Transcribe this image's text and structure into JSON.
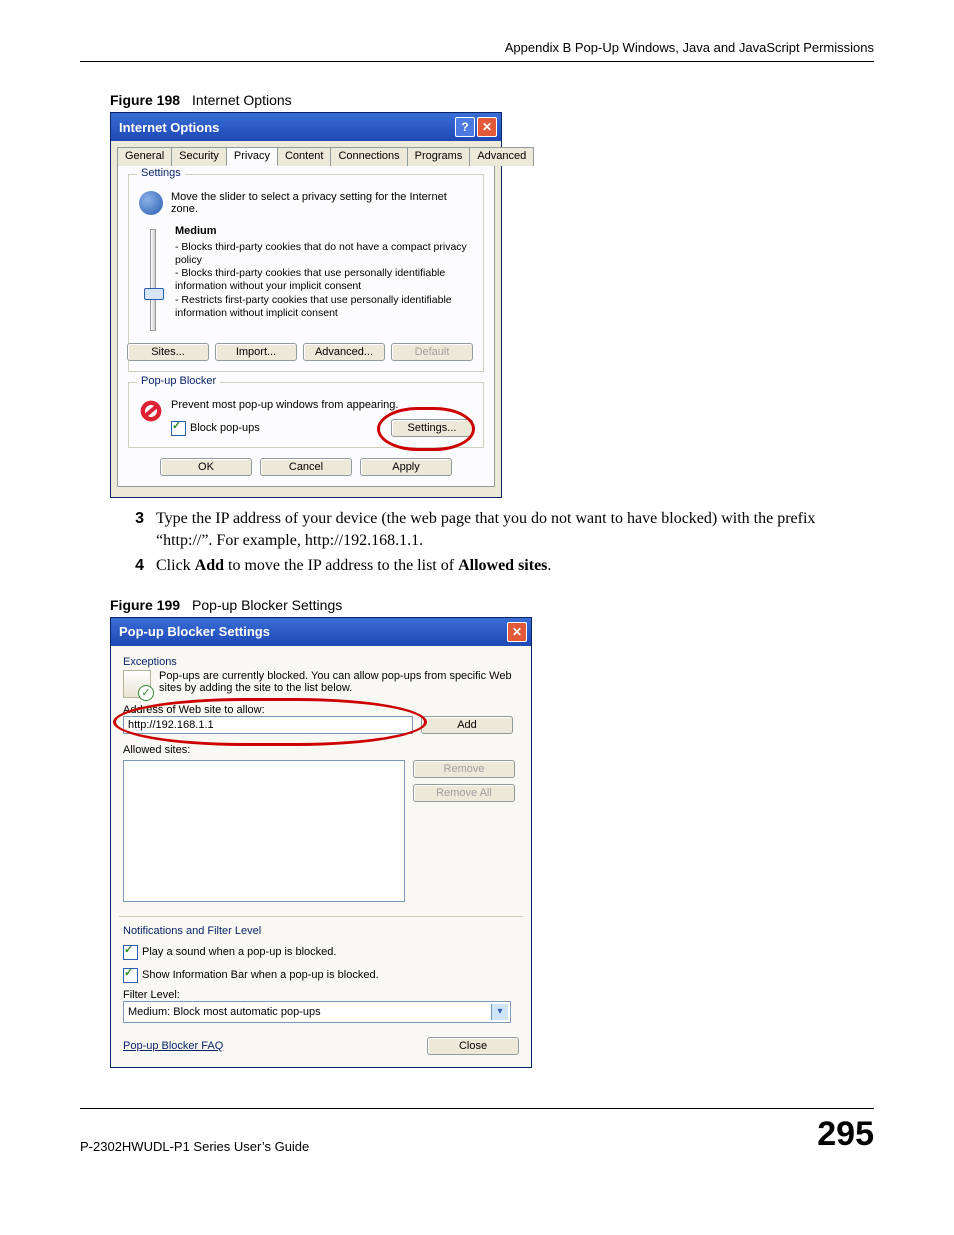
{
  "header": {
    "appendix": "Appendix B Pop-Up Windows, Java and JavaScript Permissions"
  },
  "fig198": {
    "caption_num": "Figure 198",
    "caption_title": "Internet Options",
    "title": "Internet Options",
    "tabs": {
      "general": "General",
      "security": "Security",
      "privacy": "Privacy",
      "content": "Content",
      "connections": "Connections",
      "programs": "Programs",
      "advanced": "Advanced"
    },
    "settings": {
      "legend": "Settings",
      "intro": "Move the slider to select a privacy setting for the Internet zone.",
      "level": "Medium",
      "desc1": "- Blocks third-party cookies that do not have a compact privacy policy",
      "desc2": "- Blocks third-party cookies that use personally identifiable information without your implicit consent",
      "desc3": "- Restricts first-party cookies that use personally identifiable information without implicit consent"
    },
    "buttons": {
      "sites": "Sites...",
      "import": "Import...",
      "advanced": "Advanced...",
      "default": "Default"
    },
    "popup": {
      "legend": "Pop-up Blocker",
      "desc": "Prevent most pop-up windows from appearing.",
      "block": "Block pop-ups",
      "settings": "Settings..."
    },
    "okrow": {
      "ok": "OK",
      "cancel": "Cancel",
      "apply": "Apply"
    }
  },
  "steps": {
    "s3_num": "3",
    "s3_text_a": "Type the IP address of your device (the web page that you do not want to have blocked) with the prefix “http://”. For example, http://192.168.1.1.",
    "s4_num": "4",
    "s4_a": "Click ",
    "s4_b": "Add",
    "s4_c": " to move the IP address to the list of ",
    "s4_d": "Allowed sites",
    "s4_e": "."
  },
  "fig199": {
    "caption_num": "Figure 199",
    "caption_title": "Pop-up Blocker Settings",
    "title": "Pop-up Blocker Settings",
    "exceptions": "Exceptions",
    "info": "Pop-ups are currently blocked.  You can allow pop-ups from specific Web sites by adding the site to the list below.",
    "addr_label": "Address of Web site to allow:",
    "addr_value": "http://192.168.1.1",
    "add": "Add",
    "allowed": "Allowed sites:",
    "remove": "Remove",
    "removeall": "Remove All",
    "notif_legend": "Notifications and Filter Level",
    "cb1": "Play a sound when a pop-up is blocked.",
    "cb2": "Show Information Bar when a pop-up is blocked.",
    "filter_label": "Filter Level:",
    "filter_value": "Medium: Block most automatic pop-ups",
    "faq": "Pop-up Blocker FAQ",
    "close": "Close"
  },
  "footer": {
    "guide": "P-2302HWUDL-P1 Series User’s Guide",
    "page": "295"
  }
}
